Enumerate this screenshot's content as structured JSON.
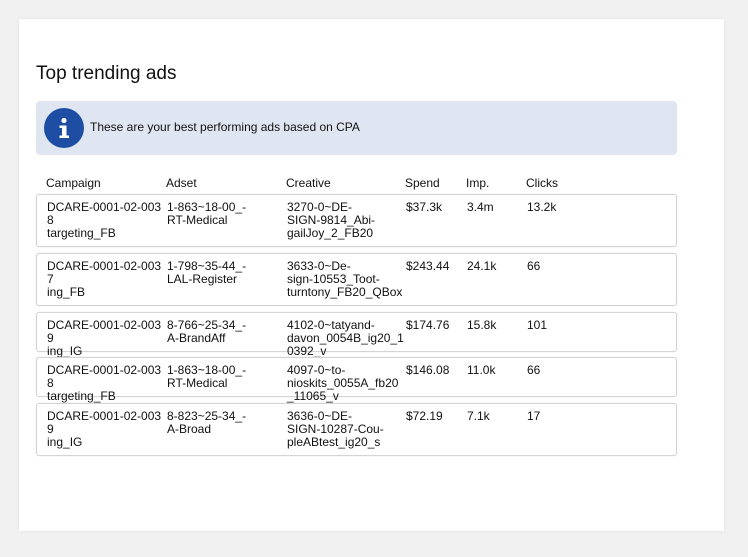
{
  "card": {
    "title": "Top trending ads",
    "banner": {
      "icon": "info-icon",
      "message": "These are your best performing ads based on CPA"
    }
  },
  "table": {
    "headers": [
      "Campaign",
      "Adset",
      "Creative",
      "Spend",
      "Imp.",
      "Clicks"
    ],
    "rows": [
      {
        "campaign": "DCARE-0001-02-0038\ntargeting_FB",
        "adset": "1-863~18-00_-\nRT-Medical",
        "creative": "3270-0~DE-\nSIGN-9814_Abi-\ngailJoy_2_FB20",
        "spend": "$37.3k",
        "imp": "3.4m",
        "clicks": "13.2k"
      },
      {
        "campaign": "DCARE-0001-02-0037\ning_FB",
        "adset": "1-798~35-44_-\nLAL-Register",
        "creative": "3633-0~De-\nsign-10553_Toot-\nturntony_FB20_QBox",
        "spend": "$243.44",
        "imp": "24.1k",
        "clicks": "66"
      },
      {
        "campaign": "DCARE-0001-02-0039\ning_IG",
        "adset": "8-766~25-34_-\nA-BrandAff",
        "creative": "4102-0~tatyand-\ndavon_0054B_ig20_10392_v",
        "spend": "$174.76",
        "imp": "15.8k",
        "clicks": "101"
      },
      {
        "campaign": "DCARE-0001-02-0038\ntargeting_FB",
        "adset": "1-863~18-00_-\nRT-Medical",
        "creative": "4097-0~to-\nnioskits_0055A_fb20_11065_v",
        "spend": "$146.08",
        "imp": "11.0k",
        "clicks": "66"
      },
      {
        "campaign": "DCARE-0001-02-0039\ning_IG",
        "adset": "8-823~25-34_-\nA-Broad",
        "creative": "3636-0~DE-\nSIGN-10287-Cou-\npleABtest_ig20_s",
        "spend": "$72.19",
        "imp": "7.1k",
        "clicks": "17"
      }
    ]
  },
  "colors": {
    "banner_bg": "#dfe6f2",
    "info_icon_bg": "#1d4ea3",
    "row_border": "#d4d4d4"
  }
}
